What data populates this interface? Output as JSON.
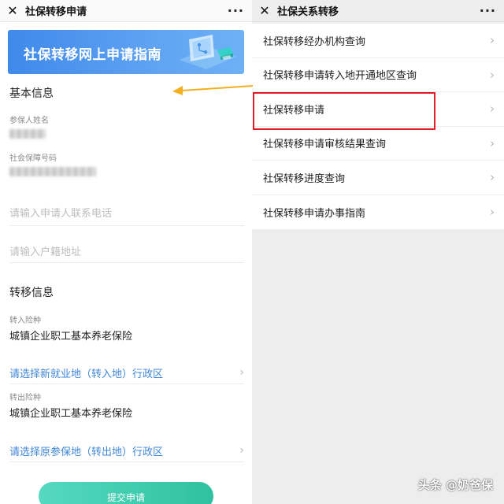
{
  "left": {
    "title": "社保转移申请",
    "more": "···",
    "banner_text": "社保转移网上申请指南",
    "basic_info_heading": "基本信息",
    "insured_name_label": "参保人姓名",
    "ss_number_label": "社会保障号码",
    "phone_placeholder": "请输入申请人联系电话",
    "address_placeholder": "请输入户籍地址",
    "transfer_info_heading": "转移信息",
    "in_type_label": "转入险种",
    "in_type_value": "城镇企业职工基本养老保险",
    "in_region_select": "请选择新就业地（转入地）行政区",
    "out_type_label": "转出险种",
    "out_type_value": "城镇企业职工基本养老保险",
    "out_region_select": "请选择原参保地（转出地）行政区",
    "submit_label": "提交申请"
  },
  "right": {
    "title": "社保关系转移",
    "more": "···",
    "items": [
      {
        "label": "社保转移经办机构查询"
      },
      {
        "label": "社保转移申请转入地开通地区查询"
      },
      {
        "label": "社保转移申请"
      },
      {
        "label": "社保转移申请审核结果查询"
      },
      {
        "label": "社保转移进度查询"
      },
      {
        "label": "社保转移申请办事指南"
      }
    ]
  },
  "watermark": "头条 @奶爸保",
  "colors": {
    "highlight_border": "#e11b2b",
    "arrow": "#f2b01e",
    "link_blue": "#3f86d8",
    "submit_green": "#2fc1a0",
    "banner_blue": "#3f89ea"
  }
}
